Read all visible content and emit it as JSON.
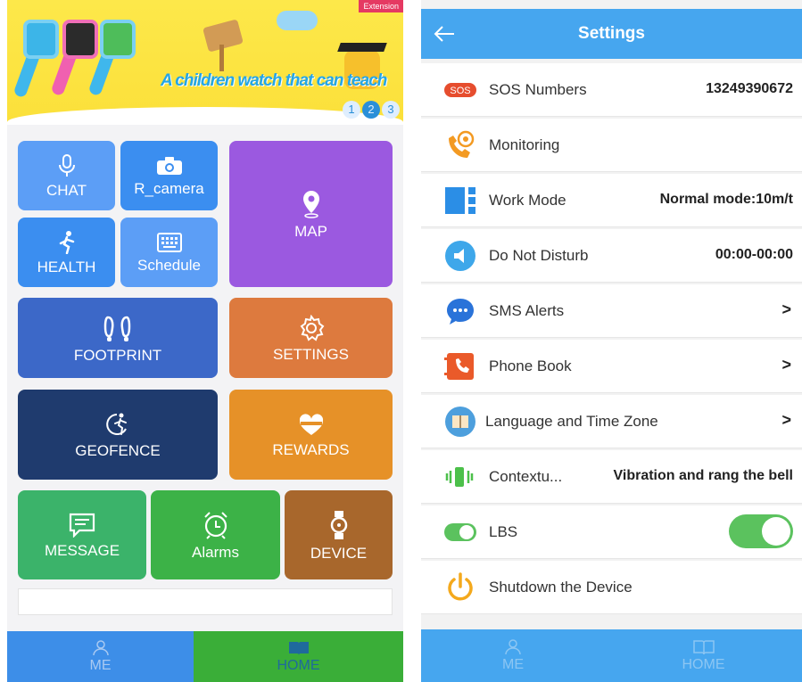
{
  "home": {
    "banner": {
      "extension_label": "Extension",
      "slogan": "A children watch that can teach",
      "pages": [
        "1",
        "2",
        "3"
      ],
      "active_page": 1
    },
    "tiles": {
      "chat": {
        "label": "CHAT",
        "icon": "microphone-icon",
        "color": "#5c9ef6"
      },
      "camera": {
        "label": "R_camera",
        "icon": "camera-icon",
        "color": "#3b8ef0"
      },
      "map": {
        "label": "MAP",
        "icon": "map-pin-icon",
        "color": "#9b59e0"
      },
      "health": {
        "label": "HEALTH",
        "icon": "running-person-icon",
        "color": "#3b8ef0"
      },
      "schedule": {
        "label": "Schedule",
        "icon": "keyboard-icon",
        "color": "#5c9ef6"
      },
      "footprint": {
        "label": "FOOTPRINT",
        "icon": "footprints-icon",
        "color": "#3c68c8"
      },
      "settings": {
        "label": "SETTINGS",
        "icon": "gear-icon",
        "color": "#dd7a3e"
      },
      "geofence": {
        "label": "GEOFENCE",
        "icon": "geofence-runner-icon",
        "color": "#1f3b6e"
      },
      "rewards": {
        "label": "REWARDS",
        "icon": "heart-ribbon-icon",
        "color": "#e69128"
      },
      "message": {
        "label": "MESSAGE",
        "icon": "message-icon",
        "color": "#3bb36a"
      },
      "alarms": {
        "label": "Alarms",
        "icon": "alarm-clock-icon",
        "color": "#3cb247"
      },
      "device": {
        "label": "DEVICE",
        "icon": "watch-icon",
        "color": "#a8672c"
      }
    },
    "tabbar": {
      "me_label": "ME",
      "home_label": "HOME",
      "me_bg": "#3d8ee8",
      "home_bg": "#3aae38",
      "active": "home"
    }
  },
  "settings": {
    "title": "Settings",
    "rows": [
      {
        "label": "SOS Numbers",
        "value": "13249390672",
        "icon": "sos-icon",
        "sos_text": "SOS"
      },
      {
        "label": "Monitoring",
        "value": "",
        "icon": "phone-monitor-icon"
      },
      {
        "label": "Work Mode",
        "value": "Normal mode:10m/t",
        "icon": "work-mode-icon"
      },
      {
        "label": "Do Not Disturb",
        "value": "00:00-00:00",
        "icon": "speaker-mute-icon"
      },
      {
        "label": "SMS Alerts",
        "value": ">",
        "icon": "chat-bubble-icon"
      },
      {
        "label": "Phone Book",
        "value": ">",
        "icon": "phone-book-icon"
      },
      {
        "label": "Language and Time Zone",
        "value": ">",
        "icon": "language-book-icon"
      },
      {
        "label": "Contextu...",
        "value": "Vibration and rang the bell",
        "icon": "vibration-icon"
      },
      {
        "label": "LBS",
        "value": "",
        "icon": "lbs-toggle-icon",
        "toggle_on": true
      },
      {
        "label": "Shutdown the Device",
        "value": "",
        "icon": "power-icon"
      }
    ],
    "tabbar": {
      "me_label": "ME",
      "home_label": "HOME",
      "bg": "#46a6ef"
    }
  }
}
